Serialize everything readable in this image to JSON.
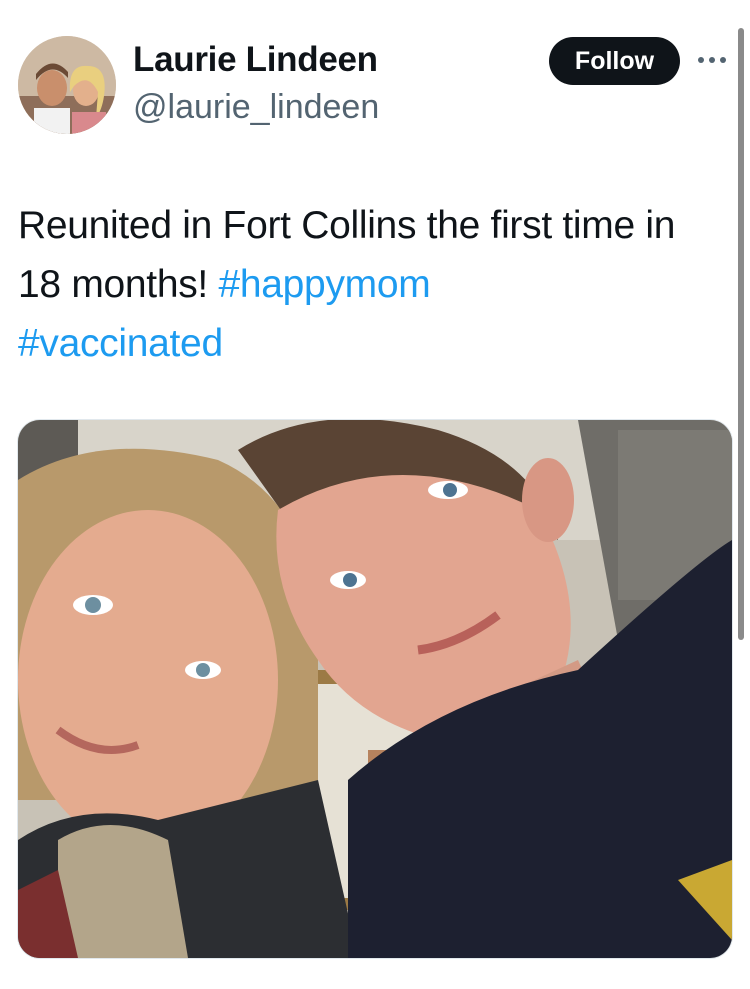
{
  "author": {
    "display_name": "Laurie Lindeen",
    "handle": "@laurie_lindeen",
    "avatar_icon": "profile-photo"
  },
  "actions": {
    "follow_label": "Follow",
    "more_icon": "more-horizontal-icon"
  },
  "tweet": {
    "text_plain": "Reunited in Fort Collins the first time in 18 months!",
    "hashtags": [
      "#happymom",
      "#vaccinated"
    ]
  },
  "media": {
    "type": "photo"
  },
  "colors": {
    "text": "#0f1419",
    "secondary_text": "#536471",
    "link": "#1d9bf0",
    "follow_bg": "#0f1419",
    "follow_text": "#ffffff"
  }
}
